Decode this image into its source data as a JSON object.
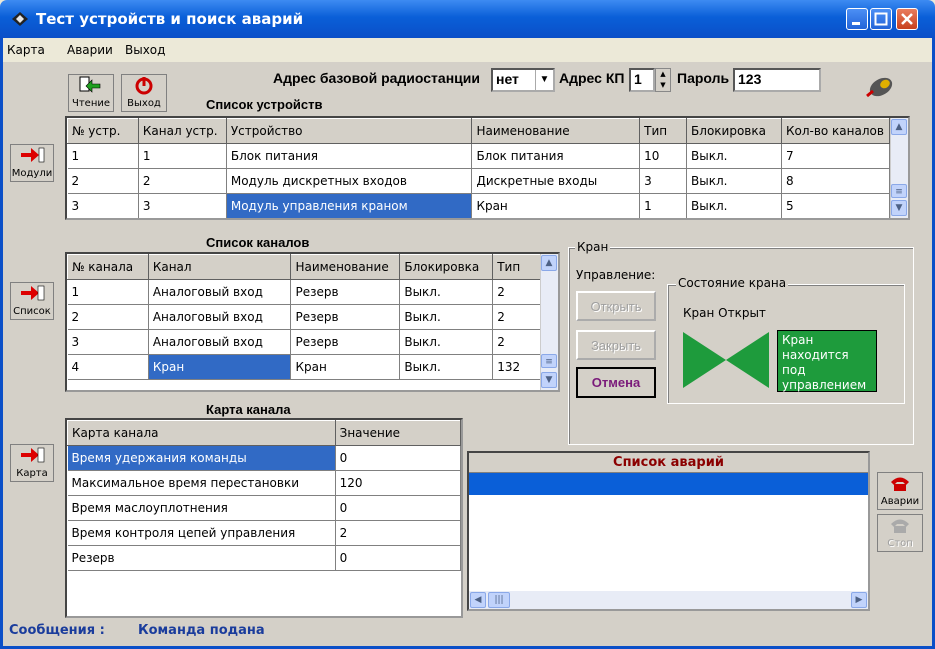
{
  "window": {
    "title": "Тест устройств и поиск аварий"
  },
  "menu": [
    "Карта",
    "Аварии",
    "Выход"
  ],
  "toolbar": {
    "read_label": "Чтение",
    "exit_label": "Выход"
  },
  "params": {
    "base_label": "Адрес базовой радиостанции",
    "base_value": "нет",
    "kp_label": "Адрес КП",
    "kp_value": "1",
    "pass_label": "Пароль",
    "pass_value": "123"
  },
  "devices": {
    "title": "Список устройств",
    "columns": [
      "№ устр.",
      "Канал устр.",
      "Устройство",
      "Наименование",
      "Тип",
      "Блокировка",
      "Кол-во каналов"
    ],
    "rows": [
      [
        "1",
        "1",
        "Блок питания",
        "Блок питания",
        "10",
        "Выкл.",
        "7"
      ],
      [
        "2",
        "2",
        "Модуль дискретных входов",
        "Дискретные входы",
        "3",
        "Выкл.",
        "8"
      ],
      [
        "3",
        "3",
        "Модуль управления краном",
        "Кран",
        "1",
        "Выкл.",
        "5"
      ]
    ]
  },
  "channels": {
    "title": "Список каналов",
    "columns": [
      "№ канала",
      "Канал",
      "Наименование",
      "Блокировка",
      "Тип"
    ],
    "rows": [
      [
        "1",
        "Аналоговый вход",
        "Резерв",
        "Выкл.",
        "2"
      ],
      [
        "2",
        "Аналоговый вход",
        "Резерв",
        "Выкл.",
        "2"
      ],
      [
        "3",
        "Аналоговый вход",
        "Резерв",
        "Выкл.",
        "2"
      ],
      [
        "4",
        "Кран",
        "Кран",
        "Выкл.",
        "132"
      ]
    ]
  },
  "chanmap": {
    "title": "Карта канала",
    "columns": [
      "Карта канала",
      "Значение"
    ],
    "rows": [
      [
        "Время удержания команды",
        "0"
      ],
      [
        "Максимальное время перестановки",
        "120"
      ],
      [
        "Время маслоуплотнения",
        "0"
      ],
      [
        "Время контроля цепей управления",
        "2"
      ],
      [
        "Резерв",
        "0"
      ]
    ]
  },
  "side": {
    "modules": "Модули",
    "list": "Список",
    "map": "Карта",
    "alarms": "Аварии",
    "stop": "Стоп"
  },
  "valve": {
    "group": "Кран",
    "control": "Управление:",
    "open": "Открыть",
    "close": "Закрыть",
    "cancel": "Отмена",
    "state_group": "Состояние крана",
    "state": "Кран Открыт",
    "status_box": "Кран находится под управлением",
    "color": "#1e9b3c"
  },
  "alarms": {
    "title": "Список аварий"
  },
  "status": {
    "label": "Сообщения :",
    "text": "Команда подана"
  }
}
